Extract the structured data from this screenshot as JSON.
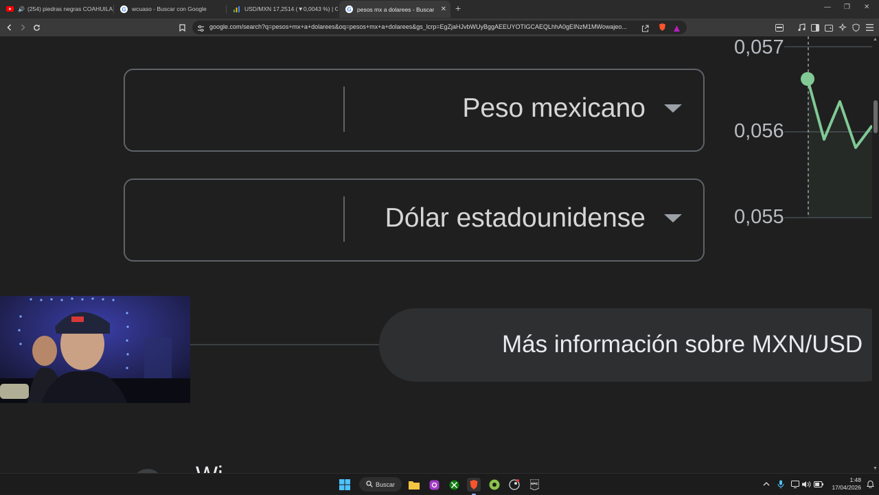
{
  "browser": {
    "tabs": [
      {
        "title": "(254) piedras negras COAHUILA",
        "favicon": "youtube-icon",
        "audio": true
      },
      {
        "title": "wcuaso - Buscar con Google",
        "favicon": "google-icon"
      },
      {
        "title": "USD/MXN 17,2514 (▼0,0043 %) | Go",
        "favicon": "chart-icon"
      },
      {
        "title": "pesos mx a dolarees - Buscar co",
        "favicon": "google-icon",
        "active": true
      }
    ],
    "new_tab_label": "+",
    "url": "google.com/search?q=pesos+mx+a+dolarees&oq=pesos+mx+a+dolarees&gs_lcrp=EgZjaHJvbWUyBggAEEUYOTIGCAEQLhhA0gEINzM1MWowajeo..."
  },
  "converter": {
    "from_currency": "Peso mexicano",
    "to_currency": "Dólar estadounidense"
  },
  "chart": {
    "y_ticks": [
      "0,057",
      "0,056",
      "0,055"
    ],
    "line_color": "#81c995"
  },
  "more_info": {
    "label": "Más información sobre MXN/USD"
  },
  "next_result": {
    "title_fragment": "Wi"
  },
  "taskbar": {
    "search_label": "Buscar",
    "time": "1:48",
    "date": "17/04/2026"
  },
  "colors": {
    "page_bg": "#1f1f1f",
    "border": "#5f6368",
    "accent_green": "#81c995"
  }
}
